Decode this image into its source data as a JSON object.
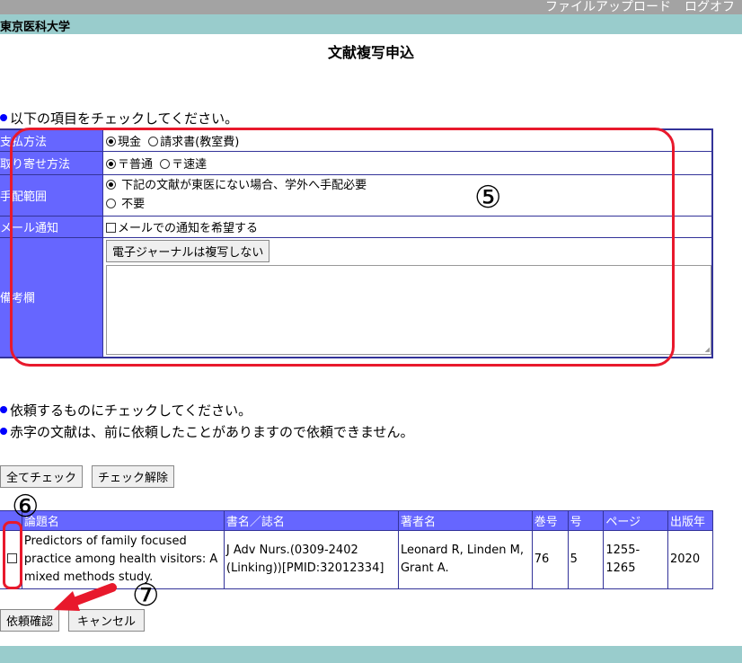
{
  "header": {
    "upload_link": "ファイルアップロード",
    "logout_link": "ログオフ",
    "org_name": "東京医科大学"
  },
  "page_title": "文献複写申込",
  "instruction1": "以下の項目をチェックしてください。",
  "options": {
    "payment": {
      "label": "支払方法",
      "opt1": "現金",
      "opt2": "請求書(教室費)"
    },
    "delivery": {
      "label": "取り寄せ方法",
      "opt1": "〒普通",
      "opt2": "〒速達"
    },
    "scope": {
      "label": "手配範囲",
      "opt1": "下記の文献が東医にない場合、学外へ手配必要",
      "opt2": "不要"
    },
    "mail": {
      "label": "メール通知",
      "checkbox_label": "メールでの通知を希望する"
    },
    "notes": {
      "label": "備考欄",
      "button": "電子ジャーナルは複写しない",
      "text": ""
    }
  },
  "instruction2": "依頼するものにチェックしてください。",
  "instruction3": "赤字の文献は、前に依頼したことがありますので依頼できません。",
  "check_all_button": "全てチェック",
  "uncheck_button": "チェック解除",
  "table": {
    "headers": [
      "論題名",
      "書名／誌名",
      "著者名",
      "巻号",
      "号",
      "ページ",
      "出版年"
    ],
    "rows": [
      {
        "title": "Predictors of family focused practice among health visitors: A mixed methods study.",
        "journal": "J Adv Nurs.(0309-2402 (Linking))[PMID:32012334]",
        "authors": "Leonard R, Linden M, Grant A.",
        "volume": "76",
        "issue": "5",
        "pages": "1255-1265",
        "year": "2020"
      }
    ]
  },
  "confirm_button": "依頼確認",
  "cancel_button": "キャンセル",
  "annotations": {
    "a5": "⑤",
    "a6": "⑥",
    "a7": "⑦"
  },
  "colors": {
    "header_gray": "#a3a3a3",
    "header_teal": "#99cccc",
    "label_blue": "#6666ff",
    "annotation_red": "#e8192c"
  }
}
